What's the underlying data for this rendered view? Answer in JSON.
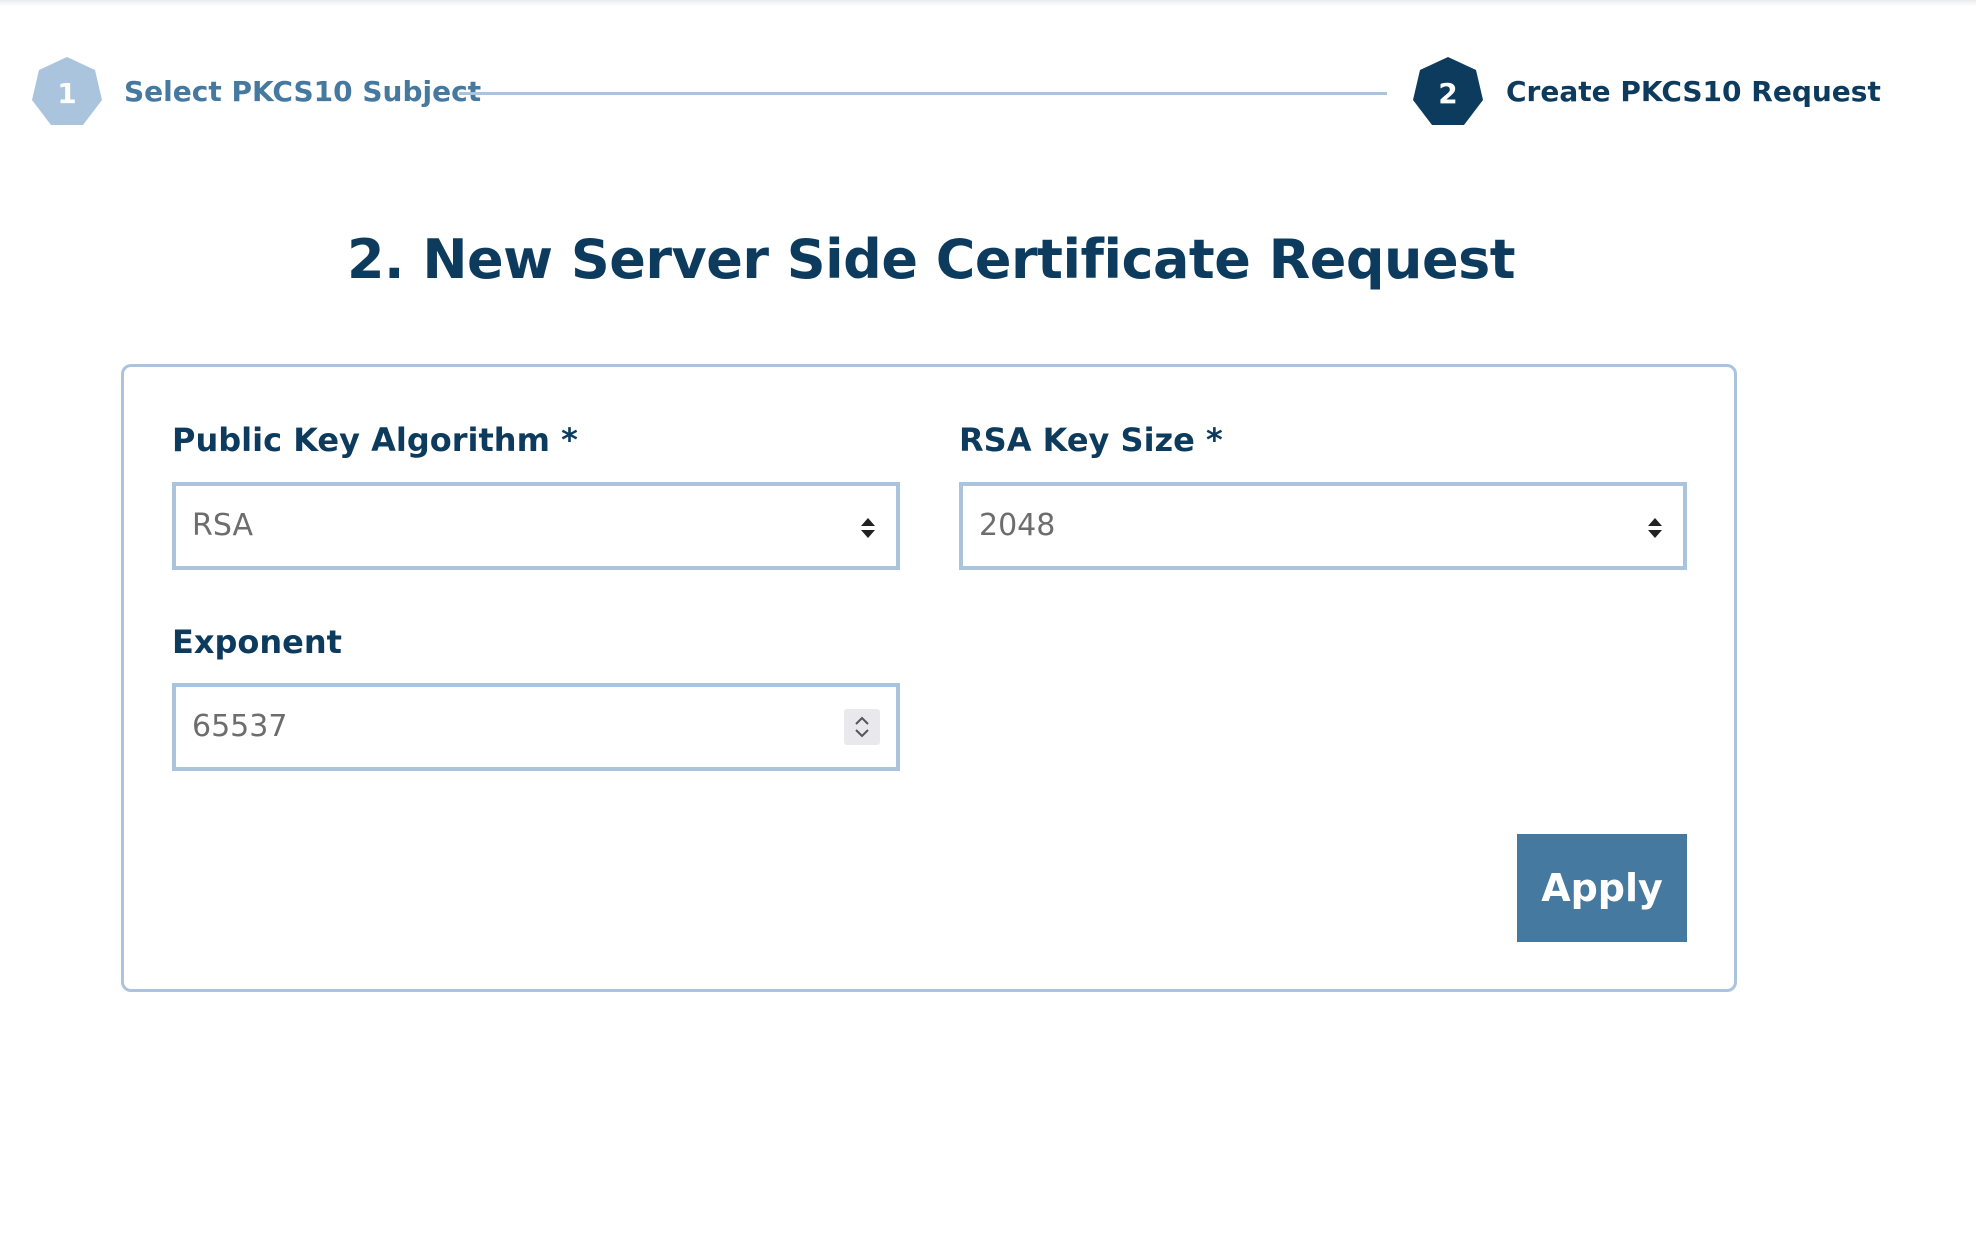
{
  "stepper": {
    "steps": [
      {
        "number": "1",
        "label": "Select PKCS10 Subject",
        "state": "completed"
      },
      {
        "number": "2",
        "label": "Create PKCS10 Request",
        "state": "active"
      }
    ]
  },
  "page": {
    "title": "2. New Server Side Certificate Request"
  },
  "form": {
    "public_key_algorithm": {
      "label": "Public Key Algorithm *",
      "value": "RSA"
    },
    "rsa_key_size": {
      "label": "RSA Key Size *",
      "value": "2048"
    },
    "exponent": {
      "label": "Exponent",
      "value": "65537"
    },
    "apply_label": "Apply"
  },
  "colors": {
    "primary_dark": "#0d3b5e",
    "primary": "#4579a0",
    "primary_light": "#a9c4dc",
    "input_text": "#6d6d6d"
  }
}
